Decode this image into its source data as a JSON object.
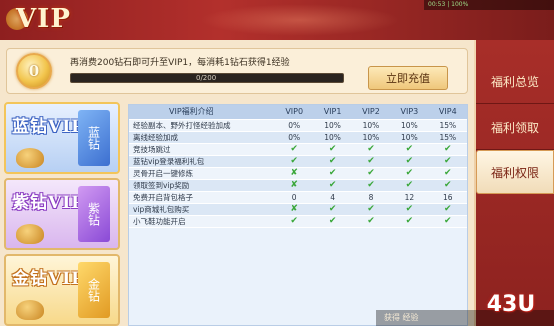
{
  "header": {
    "title": "VIP",
    "status_text": "00:53  | 100%"
  },
  "progress": {
    "medal_level": "0",
    "message": "再消费200钻石即可升至VIP1，每消耗1钻石获得1经验",
    "value_text": "0/200",
    "fill_fraction": 0.0,
    "recharge_label": "立即充值"
  },
  "cards": [
    {
      "label": "蓝钻VIP",
      "book_text": "蓝钻"
    },
    {
      "label": "紫钻VIP",
      "book_text": "紫钻"
    },
    {
      "label": "金钻VIP",
      "book_text": "金钻"
    }
  ],
  "table": {
    "headers": [
      "VIP福利介绍",
      "VIP0",
      "VIP1",
      "VIP2",
      "VIP3",
      "VIP4"
    ],
    "rows": [
      [
        "经验副本、野外打怪经验加成",
        "0%",
        "10%",
        "10%",
        "10%",
        "15%"
      ],
      [
        "离线经验加成",
        "0%",
        "10%",
        "10%",
        "10%",
        "15%"
      ],
      [
        "竞技场跳过",
        "✔",
        "✔",
        "✔",
        "✔",
        "✔"
      ],
      [
        "蓝钻vip登录福利礼包",
        "✔",
        "✔",
        "✔",
        "✔",
        "✔"
      ],
      [
        "灵骨开启一键修炼",
        "✘",
        "✔",
        "✔",
        "✔",
        "✔"
      ],
      [
        "领取签到vip奖励",
        "✘",
        "✔",
        "✔",
        "✔",
        "✔"
      ],
      [
        "免费开启背包格子",
        "0",
        "4",
        "8",
        "12",
        "16"
      ],
      [
        "vip商城礼包购买",
        "✘",
        "✔",
        "✔",
        "✔",
        "✔"
      ],
      [
        "小飞鞋功能开启",
        "✔",
        "✔",
        "✔",
        "✔",
        "✔"
      ]
    ]
  },
  "side_tabs": [
    {
      "label": "福利总览",
      "active": false
    },
    {
      "label": "福利领取",
      "active": false
    },
    {
      "label": "福利权限",
      "active": true
    }
  ],
  "footer": {
    "watermark": "43U",
    "bottom_text": "获得 经验"
  },
  "colors": {
    "accent_red": "#a82e29",
    "check_green": "#3aa73a",
    "progress_green": "#6ccf4b"
  }
}
